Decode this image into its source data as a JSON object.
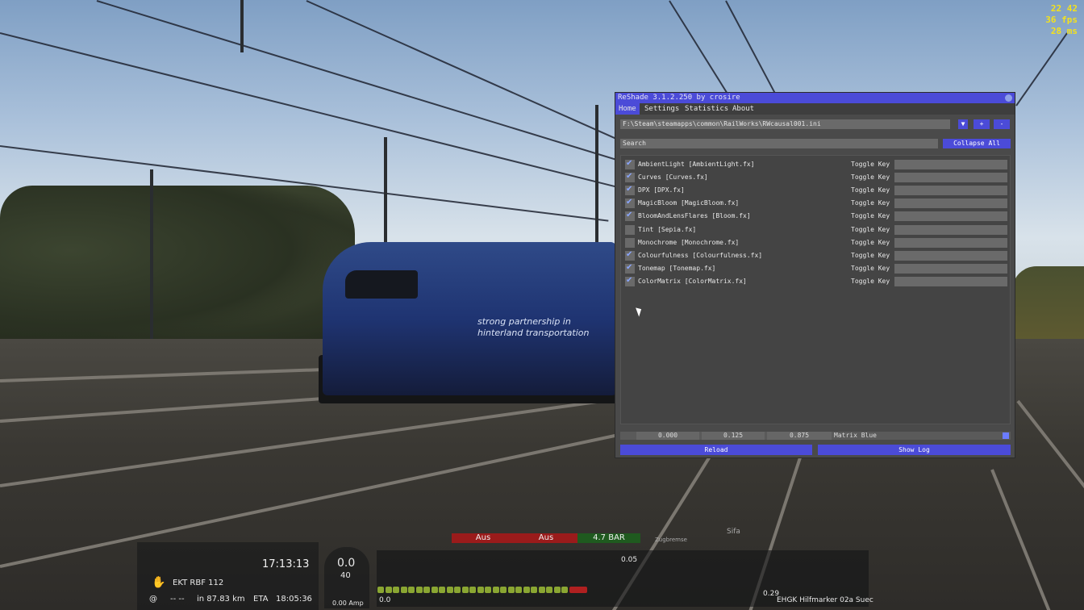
{
  "overlay": {
    "clock": "22 42",
    "fps": "36 fps",
    "frametime": "28 ms"
  },
  "reshade": {
    "title": "ReShade 3.1.2.250 by crosire",
    "tabs": [
      "Home",
      "Settings",
      "Statistics",
      "About"
    ],
    "active_tab": "Home",
    "preset_path": "F:\\Steam\\steamapps\\common\\RailWorks\\RWcausal001.ini",
    "add_label": "+",
    "remove_label": "-",
    "search_placeholder": "Search",
    "collapse_label": "Collapse All",
    "toggle_key_label": "Toggle Key",
    "effects": [
      {
        "label": "AmbientLight [AmbientLight.fx]",
        "checked": true
      },
      {
        "label": "Curves [Curves.fx]",
        "checked": true
      },
      {
        "label": "DPX [DPX.fx]",
        "checked": true
      },
      {
        "label": "MagicBloom [MagicBloom.fx]",
        "checked": true
      },
      {
        "label": "BloomAndLensFlares [Bloom.fx]",
        "checked": true
      },
      {
        "label": "Tint [Sepia.fx]",
        "checked": false
      },
      {
        "label": "Monochrome [Monochrome.fx]",
        "checked": false
      },
      {
        "label": "Colourfulness [Colourfulness.fx]",
        "checked": true
      },
      {
        "label": "Tonemap [Tonemap.fx]",
        "checked": true
      },
      {
        "label": "ColorMatrix [ColorMatrix.fx]",
        "checked": true
      }
    ],
    "values": [
      "0.000",
      "0.125",
      "0.875"
    ],
    "value_name": "Matrix Blue",
    "reload_label": "Reload",
    "show_log_label": "Show Log"
  },
  "train_livery": {
    "line1": "strong partnership in",
    "line2": "hinterland transportation"
  },
  "hud": {
    "time": "17:13:13",
    "service": "EKT RBF 112",
    "at_symbol": "@",
    "dashes": "-- --",
    "distance": "in 87.83 km",
    "eta_label": "ETA",
    "eta": "18:05:36",
    "speed": "0.0",
    "speed_limit": "40",
    "amps": "0.00 Amp",
    "status": [
      {
        "label": "Aus",
        "color": "#b01818"
      },
      {
        "label": "Aus",
        "color": "#b01818"
      },
      {
        "label": "4.7 BAR",
        "color": "#1e6a1e"
      }
    ],
    "zugbremse": "Zugbremse",
    "sifa": "Sifa",
    "track_start": "0.0",
    "track_marker": "0.05",
    "track_far": "0.29",
    "next_signal": "EHGK Hilfmarker 02a Suec"
  }
}
